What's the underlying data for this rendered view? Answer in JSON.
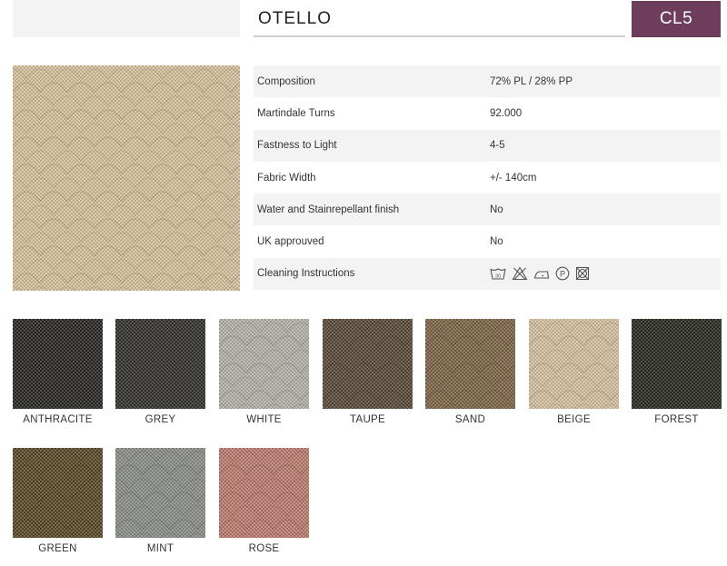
{
  "product": {
    "name": "OTELLO",
    "collection_code": "CL5"
  },
  "specs": [
    {
      "label": "Composition",
      "value": "72% PL / 28% PP"
    },
    {
      "label": "Martindale Turns",
      "value": "92.000"
    },
    {
      "label": "Fastness to Light",
      "value": "4-5"
    },
    {
      "label": "Fabric Width",
      "value": "+/- 140cm"
    },
    {
      "label": "Water and Stainrepellant finish",
      "value": "No"
    },
    {
      "label": "UK approuved",
      "value": "No"
    },
    {
      "label": "Cleaning Instructions",
      "value": ""
    }
  ],
  "care_icons": [
    "wash-30-icon",
    "no-bleach-icon",
    "iron-low-icon",
    "dry-clean-p-icon",
    "no-tumble-dry-icon"
  ],
  "care_wash_temp": "30",
  "care_dry_clean_letter": "P",
  "swatches": [
    {
      "name": "ANTHRACITE",
      "color": "#2a2824"
    },
    {
      "name": "GREY",
      "color": "#34322d"
    },
    {
      "name": "WHITE",
      "color": "#b4b0a8"
    },
    {
      "name": "TAUPE",
      "color": "#5a4a3a"
    },
    {
      "name": "SAND",
      "color": "#7e6548"
    },
    {
      "name": "BEIGE",
      "color": "#d4c0a0"
    },
    {
      "name": "FOREST",
      "color": "#2a2c22"
    },
    {
      "name": "GREEN",
      "color": "#5a4a28"
    },
    {
      "name": "MINT",
      "color": "#8a8e86"
    },
    {
      "name": "ROSE",
      "color": "#bc7c70"
    }
  ],
  "hero_color": "#d6c09c",
  "accent_color": "#6e3d5b"
}
